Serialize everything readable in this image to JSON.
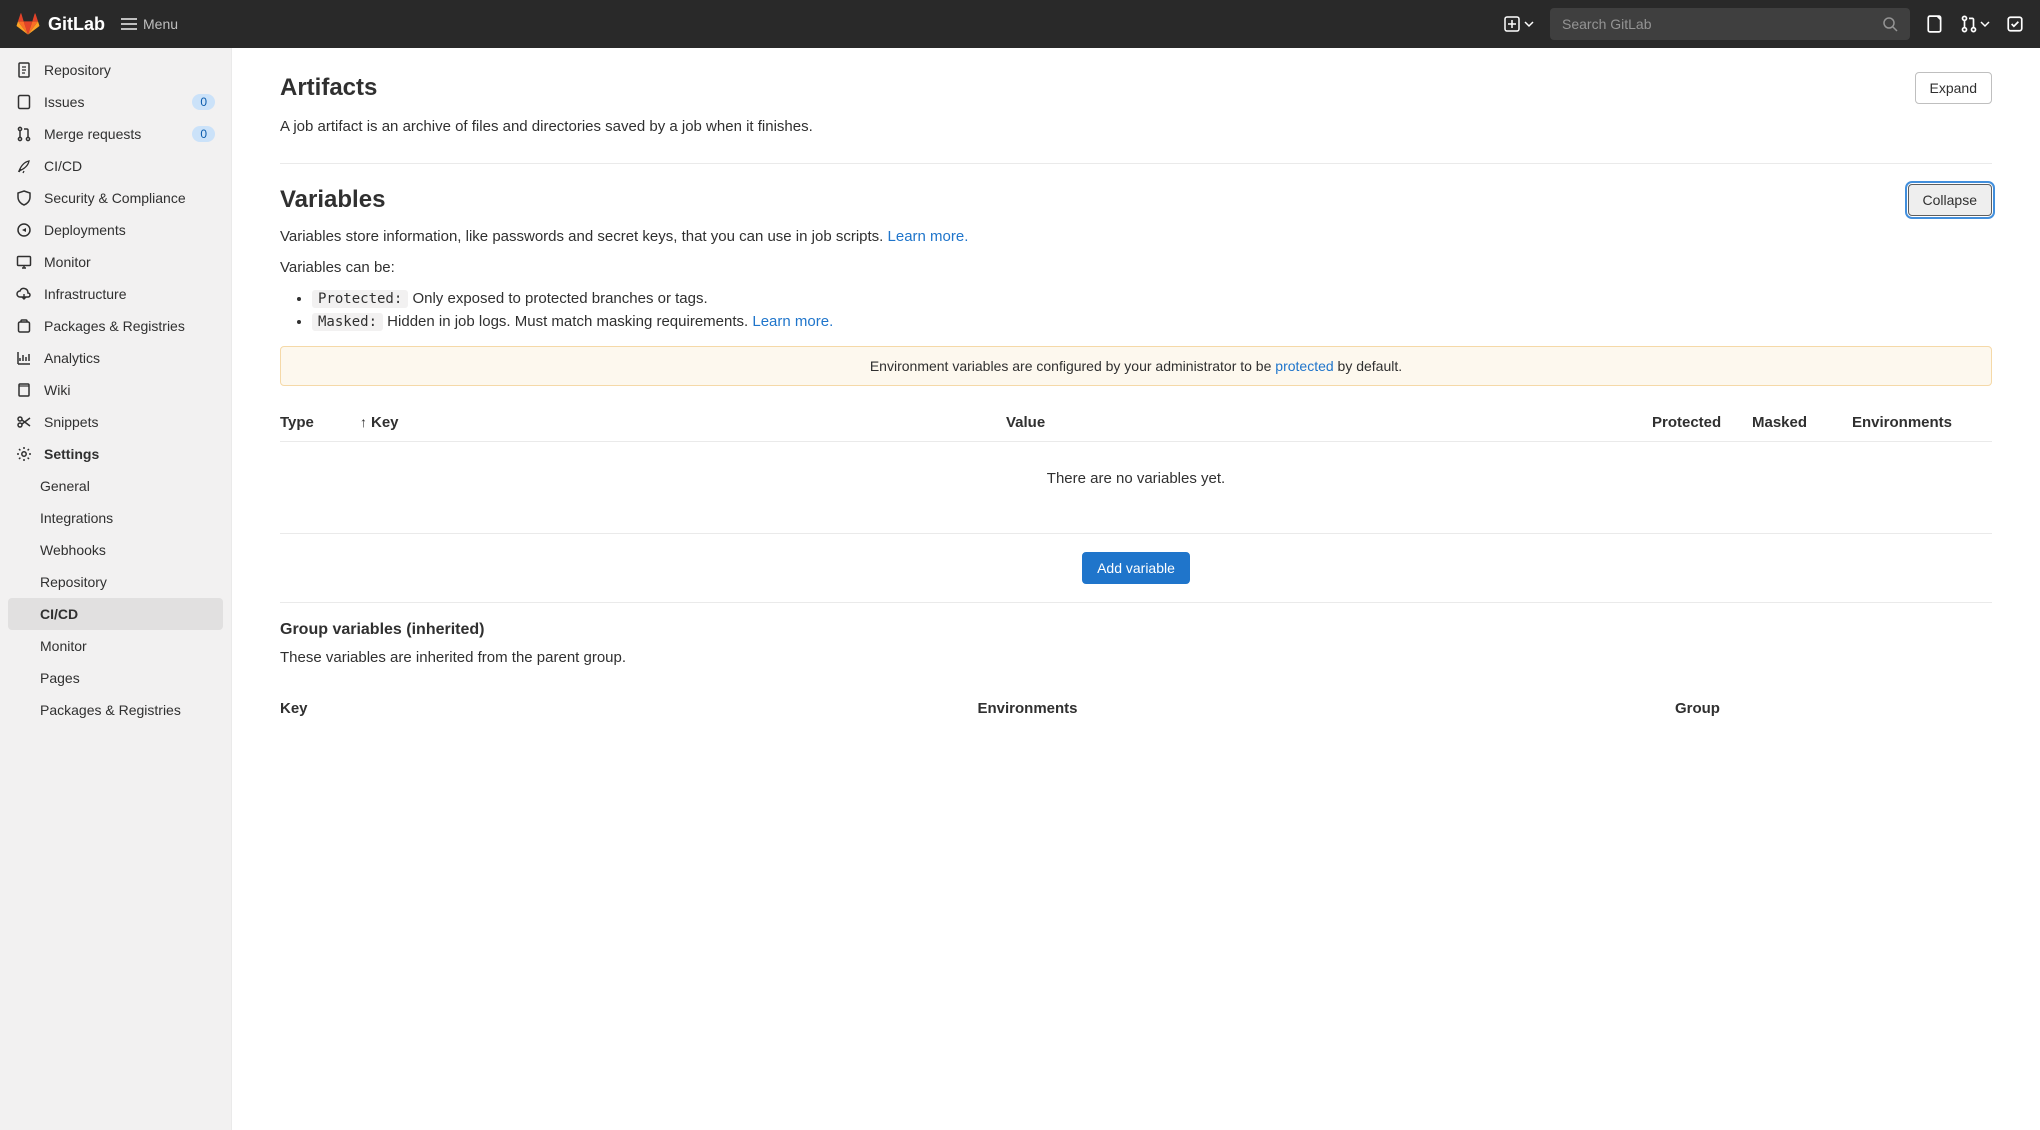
{
  "brand": "GitLab",
  "menu_label": "Menu",
  "search_placeholder": "Search GitLab",
  "sidebar": {
    "repository": "Repository",
    "issues": "Issues",
    "issues_badge": "0",
    "merge_requests": "Merge requests",
    "mr_badge": "0",
    "cicd": "CI/CD",
    "security": "Security & Compliance",
    "deployments": "Deployments",
    "monitor": "Monitor",
    "infrastructure": "Infrastructure",
    "packages": "Packages & Registries",
    "analytics": "Analytics",
    "wiki": "Wiki",
    "snippets": "Snippets",
    "settings": "Settings",
    "subitems": {
      "general": "General",
      "integrations": "Integrations",
      "webhooks": "Webhooks",
      "repository": "Repository",
      "cicd": "CI/CD",
      "monitor": "Monitor",
      "pages": "Pages",
      "packages": "Packages & Registries"
    }
  },
  "artifacts": {
    "title": "Artifacts",
    "desc": "A job artifact is an archive of files and directories saved by a job when it finishes.",
    "expand_btn": "Expand"
  },
  "variables": {
    "title": "Variables",
    "collapse_btn": "Collapse",
    "intro1": "Variables store information, like passwords and secret keys, that you can use in job scripts. ",
    "learn_more": "Learn more.",
    "intro2": "Variables can be:",
    "protected_tag": "Protected:",
    "protected_desc": " Only exposed to protected branches or tags.",
    "masked_tag": "Masked:",
    "masked_desc": " Hidden in job logs. Must match masking requirements. ",
    "alert_pre": "Environment variables are configured by your administrator to be ",
    "alert_link": "protected",
    "alert_post": " by default.",
    "cols": {
      "type": "Type",
      "key": "Key",
      "value": "Value",
      "protected": "Protected",
      "masked": "Masked",
      "environments": "Environments"
    },
    "empty": "There are no variables yet.",
    "add_btn": "Add variable"
  },
  "group_vars": {
    "title": "Group variables (inherited)",
    "desc": "These variables are inherited from the parent group.",
    "cols": {
      "key": "Key",
      "environments": "Environments",
      "group": "Group"
    }
  }
}
